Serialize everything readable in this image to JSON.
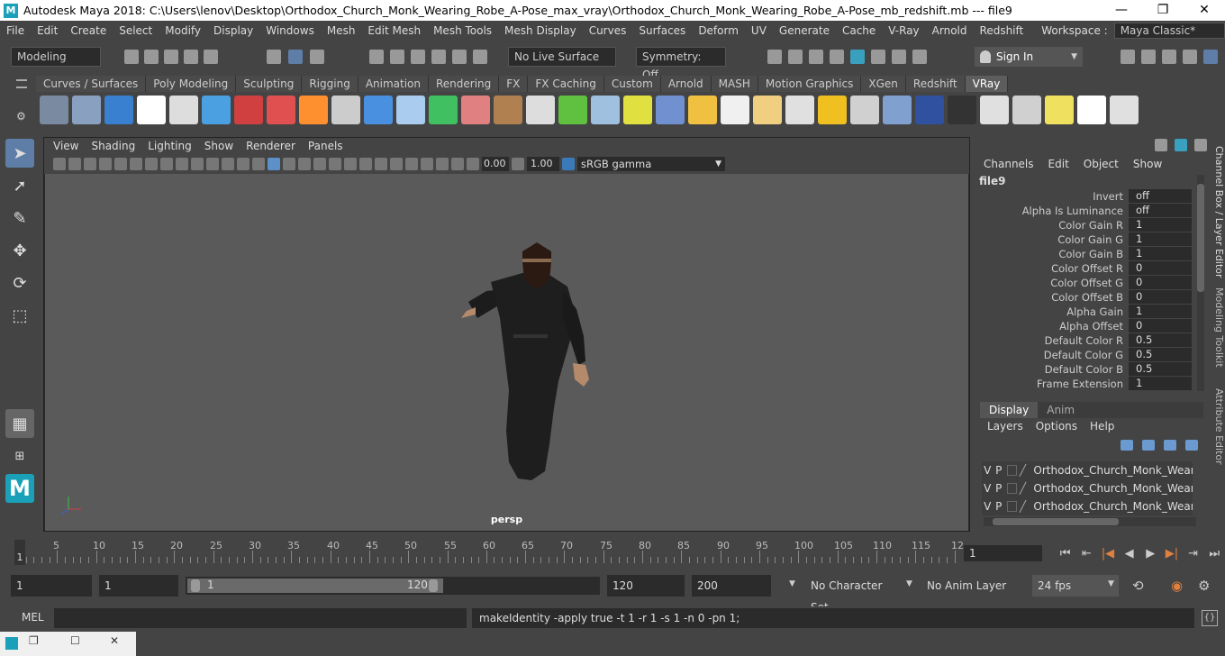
{
  "window": {
    "title": "Autodesk Maya 2018: C:\\Users\\lenov\\Desktop\\Orthodox_Church_Monk_Wearing_Robe_A-Pose_max_vray\\Orthodox_Church_Monk_Wearing_Robe_A-Pose_mb_redshift.mb   ---   file9",
    "minimize": "—",
    "maximize": "❐",
    "close": "✕"
  },
  "menubar": [
    "File",
    "Edit",
    "Create",
    "Select",
    "Modify",
    "Display",
    "Windows",
    "Mesh",
    "Edit Mesh",
    "Mesh Tools",
    "Mesh Display",
    "Curves",
    "Surfaces",
    "Deform",
    "UV",
    "Generate",
    "Cache",
    "V-Ray",
    "Arnold",
    "Redshift"
  ],
  "workspace": {
    "label": "Workspace :",
    "value": "Maya Classic*"
  },
  "statusline": {
    "mode": "Modeling",
    "live_surface": "No Live Surface",
    "symmetry": "Symmetry: Off",
    "sign_in": "Sign In"
  },
  "shelf_tabs": [
    "Curves / Surfaces",
    "Poly Modeling",
    "Sculpting",
    "Rigging",
    "Animation",
    "Rendering",
    "FX",
    "FX Caching",
    "Custom",
    "Arnold",
    "MASH",
    "Motion Graphics",
    "XGen",
    "Redshift",
    "VRay"
  ],
  "shelf_active": "VRay",
  "shelf_icons": [
    "#7a8aa0",
    "#8aa0c0",
    "#3a80d0",
    "#ffffff",
    "#ddd",
    "#4aa0e0",
    "#d04040",
    "#e05050",
    "#ff9030",
    "#cccccc",
    "#4a90e0",
    "#aaccee",
    "#40c060",
    "#e08080",
    "#b08050",
    "#ddd",
    "#60c040",
    "#a0c0e0",
    "#e0e040",
    "#7090d0",
    "#f0c040",
    "#f0f0f0",
    "#f0d080",
    "#e0e0e0",
    "#f0c020",
    "#d0d0d0",
    "#80a0d0",
    "#3050a0",
    "#333",
    "#e0e0e0",
    "#d0d0d0",
    "#f0e060",
    "#ffffff",
    "#e0e0e0"
  ],
  "viewport": {
    "menu": [
      "View",
      "Shading",
      "Lighting",
      "Show",
      "Renderer",
      "Panels"
    ],
    "exposure": "0.00",
    "gamma": "1.00",
    "color_space": "sRGB gamma",
    "camera": "persp"
  },
  "channel_box": {
    "menu": [
      "Channels",
      "Edit",
      "Object",
      "Show"
    ],
    "node": "file9",
    "attributes": [
      {
        "label": "Invert",
        "value": "off"
      },
      {
        "label": "Alpha Is Luminance",
        "value": "off"
      },
      {
        "label": "Color Gain R",
        "value": "1"
      },
      {
        "label": "Color Gain G",
        "value": "1"
      },
      {
        "label": "Color Gain B",
        "value": "1"
      },
      {
        "label": "Color Offset R",
        "value": "0"
      },
      {
        "label": "Color Offset G",
        "value": "0"
      },
      {
        "label": "Color Offset B",
        "value": "0"
      },
      {
        "label": "Alpha Gain",
        "value": "1"
      },
      {
        "label": "Alpha Offset",
        "value": "0"
      },
      {
        "label": "Default Color R",
        "value": "0.5"
      },
      {
        "label": "Default Color G",
        "value": "0.5"
      },
      {
        "label": "Default Color B",
        "value": "0.5"
      },
      {
        "label": "Frame Extension",
        "value": "1"
      }
    ]
  },
  "layer_editor": {
    "tabs": [
      "Display",
      "Anim"
    ],
    "menu": [
      "Layers",
      "Options",
      "Help"
    ],
    "layers": [
      {
        "v": "V",
        "p": "P",
        "name": "Orthodox_Church_Monk_Wearing"
      },
      {
        "v": "V",
        "p": "P",
        "name": "Orthodox_Church_Monk_Wearing"
      },
      {
        "v": "V",
        "p": "P",
        "name": "Orthodox_Church_Monk_Wearing"
      }
    ]
  },
  "side_tabs": [
    "Channel Box / Layer Editor",
    "Modeling Toolkit",
    "Attribute Editor"
  ],
  "timeline": {
    "ticks": [
      "5",
      "10",
      "15",
      "20",
      "25",
      "30",
      "35",
      "40",
      "45",
      "50",
      "55",
      "60",
      "65",
      "70",
      "75",
      "80",
      "85",
      "90",
      "95",
      "100",
      "105",
      "110",
      "115",
      "12"
    ],
    "current_marker": "1",
    "current_frame": "1"
  },
  "range": {
    "start": "1",
    "playback_start": "1",
    "slider_start": "1",
    "slider_end": "120",
    "playback_end": "120",
    "end": "200",
    "character_set": "No Character Set",
    "anim_layer": "No Anim Layer",
    "fps": "24 fps"
  },
  "command": {
    "lang": "MEL",
    "result": "makeIdentity -apply true -t 1 -r 1 -s 1 -n 0 -pn 1;"
  }
}
